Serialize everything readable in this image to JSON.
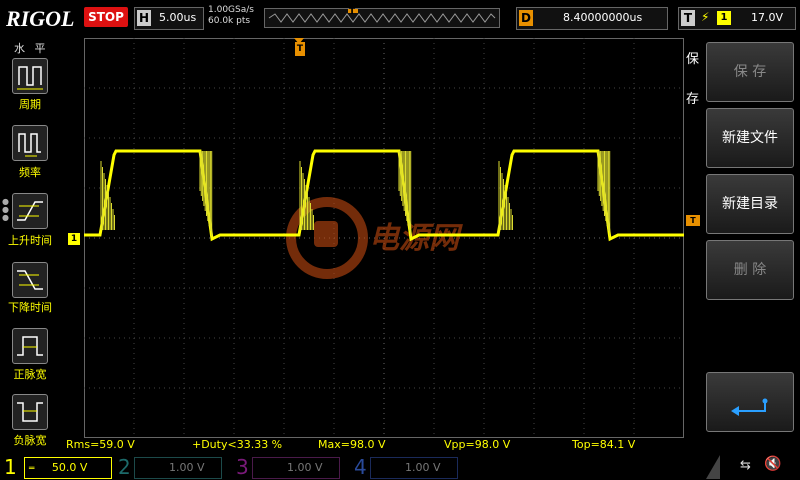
{
  "brand": "RIGOL",
  "run_state": "STOP",
  "horizontal": {
    "letter": "H",
    "timebase": "5.00us",
    "sample_rate": "1.00GSa/s",
    "memory": "60.0k pts"
  },
  "delay": {
    "letter": "D",
    "value": "8.40000000us"
  },
  "trigger": {
    "letter": "T",
    "slope": "⚡",
    "source": "1",
    "level": "17.0V"
  },
  "left_menu": {
    "title": "水 平",
    "items": [
      {
        "label": "周期",
        "icon": "period-icon"
      },
      {
        "label": "频率",
        "icon": "frequency-icon"
      },
      {
        "label": "上升时间",
        "icon": "rise-time-icon"
      },
      {
        "label": "下降时间",
        "icon": "fall-time-icon"
      },
      {
        "label": "正脉宽",
        "icon": "positive-width-icon"
      },
      {
        "label": "负脉宽",
        "icon": "negative-width-icon"
      }
    ]
  },
  "right_menu": {
    "vertical_label": [
      "保",
      "存"
    ],
    "buttons": [
      {
        "label": "保 存",
        "enabled": false
      },
      {
        "label": "新建文件",
        "enabled": true
      },
      {
        "label": "新建目录",
        "enabled": true
      },
      {
        "label": "删 除",
        "enabled": false
      }
    ],
    "back_icon": "return-arrow-icon"
  },
  "markers": {
    "trigger_pos": "T",
    "ch1_ground": "1",
    "trigger_level": "T"
  },
  "watermark": "电源网",
  "measurements": [
    {
      "text": "Rms=59.0 V"
    },
    {
      "text": "+Duty<33.33 %"
    },
    {
      "text": "Max=98.0 V"
    },
    {
      "text": "Vpp=98.0 V"
    },
    {
      "text": "Top=84.1 V"
    }
  ],
  "channels": [
    {
      "num": "1",
      "scale": "50.0 V",
      "color": "#ffff00",
      "active": true
    },
    {
      "num": "2",
      "scale": "1.00 V",
      "color": "#00a0a0",
      "active": false
    },
    {
      "num": "3",
      "scale": "1.00 V",
      "color": "#c000c0",
      "active": false
    },
    {
      "num": "4",
      "scale": "1.00 V",
      "color": "#2060ff",
      "active": false
    }
  ],
  "colors": {
    "ch1": "#ffff00",
    "grid": "#444444",
    "accent": "#e89000",
    "stop": "#dd1111"
  }
}
